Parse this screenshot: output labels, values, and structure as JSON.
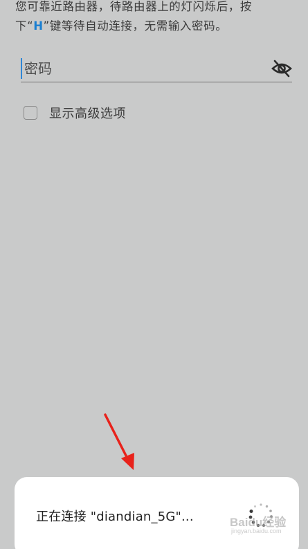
{
  "hint": {
    "line1": "您可靠近路由器，待路由器上的灯闪烁后，按",
    "line2_pre": "下“",
    "line2_key": "H",
    "line2_post": "”键等待自动连接，无需输入密码。"
  },
  "password": {
    "placeholder": "密码",
    "value": "",
    "toggle_icon": "eye-off-icon"
  },
  "advanced": {
    "label": "显示高级选项",
    "checked": false
  },
  "toast": {
    "text": "正在连接 \"diandian_5G\"...",
    "spinner_icon": "loading-spinner-icon"
  },
  "watermark": {
    "brand": "Baidu经验",
    "url": "jingyan.baidu.com"
  },
  "colors": {
    "background": "#c9caca",
    "accent": "#1a7fd1",
    "arrow": "#e8221b",
    "toast_bg": "#ffffff"
  }
}
